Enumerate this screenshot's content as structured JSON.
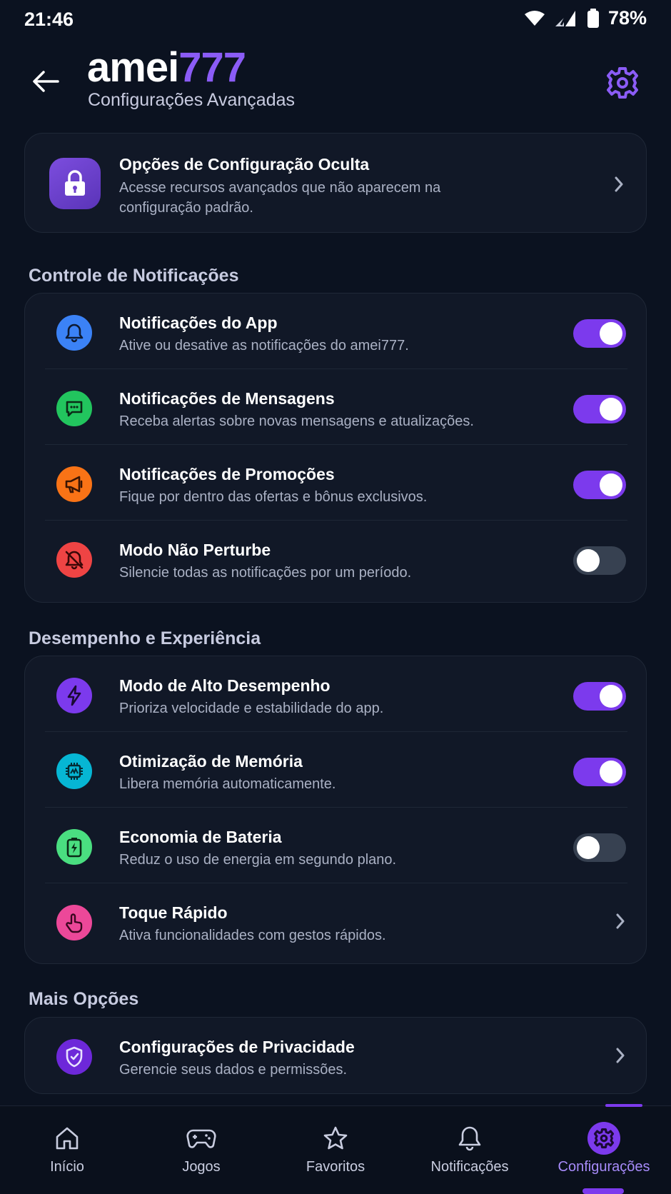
{
  "status_bar": {
    "time": "21:46",
    "battery_percent": "78%",
    "icons": [
      "wifi-icon",
      "signal-icon",
      "battery-icon"
    ]
  },
  "header": {
    "brand_part1": "amei",
    "brand_part2": "777",
    "subtitle": "Configurações Avançadas"
  },
  "hidden_options": {
    "title": "Opções de Configuração Oculta",
    "description": "Acesse recursos avançados que não aparecem na configuração padrão.",
    "icon": "lock-icon"
  },
  "sections": {
    "notifications": {
      "title": "Controle de Notificações",
      "items": [
        {
          "title": "Notificações do App",
          "description": "Ative ou desative as notificações do amei777.",
          "icon": "bell-icon",
          "enabled": true,
          "color": "#3b82f6"
        },
        {
          "title": "Notificações de Mensagens",
          "description": "Receba alertas sobre novas mensagens e atualizações.",
          "icon": "message-icon",
          "enabled": true,
          "color": "#22c55e"
        },
        {
          "title": "Notificações de Promoções",
          "description": "Fique por dentro das ofertas e bônus exclusivos.",
          "icon": "megaphone-icon",
          "enabled": true,
          "color": "#f97316"
        },
        {
          "title": "Modo Não Perturbe",
          "description": "Silencie todas as notificações por um período.",
          "icon": "bell-off-icon",
          "enabled": false,
          "color": "#ef4444"
        }
      ]
    },
    "performance": {
      "title": "Desempenho e Experiência",
      "items": [
        {
          "title": "Modo de Alto Desempenho",
          "description": "Prioriza velocidade e estabilidade do app.",
          "icon": "lightning-icon",
          "enabled": true,
          "color": "#7c3aed"
        },
        {
          "title": "Otimização de Memória",
          "description": "Libera memória automaticamente.",
          "icon": "chip-icon",
          "enabled": true,
          "color": "#06b6d4"
        },
        {
          "title": "Economia de Bateria",
          "description": "Reduz o uso de energia em segundo plano.",
          "icon": "battery-saver-icon",
          "enabled": false,
          "color": "#22c55e"
        },
        {
          "title": "Toque Rápido",
          "description": "Ativa funcionalidades com gestos rápidos.",
          "icon": "touch-icon",
          "color": "#ec4899"
        }
      ]
    },
    "more": {
      "title": "Mais Opções",
      "items": [
        {
          "title": "Configurações de Privacidade",
          "description": "Gerencie seus dados e permissões.",
          "icon": "shield-icon",
          "color": "#6d28d9"
        }
      ]
    }
  },
  "bottom_nav": {
    "items": [
      {
        "label": "Início",
        "icon": "home-icon"
      },
      {
        "label": "Jogos",
        "icon": "gamepad-icon"
      },
      {
        "label": "Favoritos",
        "icon": "star-icon"
      },
      {
        "label": "Notificações",
        "icon": "bell-icon"
      },
      {
        "label": "Configurações",
        "icon": "gear-icon",
        "active": true
      }
    ]
  },
  "colors": {
    "background": "#0b1220",
    "card": "#111827",
    "accent": "#7c3aed",
    "accent_light": "#a78bfa"
  }
}
